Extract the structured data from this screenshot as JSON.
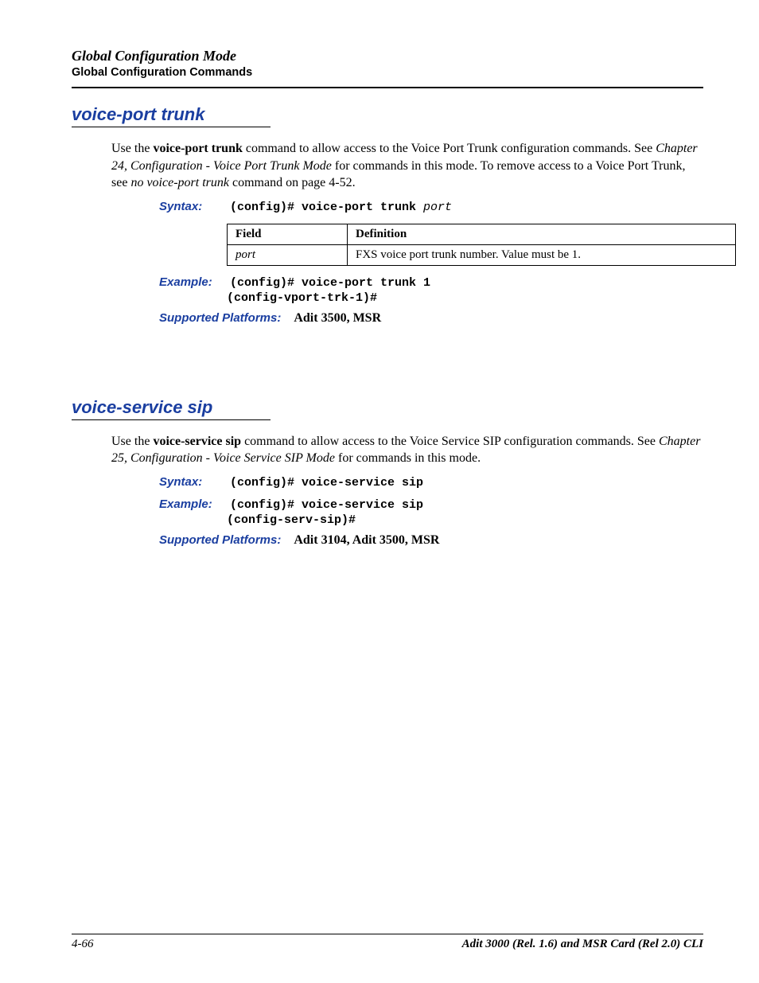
{
  "header": {
    "title": "Global Configuration Mode",
    "subtitle": "Global Configuration Commands"
  },
  "sections": [
    {
      "title": "voice-port trunk",
      "para": {
        "pre": "Use the ",
        "cmd": "voice-port trunk",
        "post1": " command to allow access to the Voice Port Trunk configuration commands. See ",
        "ref": "Chapter 24, Configuration - Voice Port Trunk Mode",
        "post2": " for commands in this mode. To remove access to a Voice Port Trunk, see  ",
        "ref2": "no voice-port trunk",
        "post3": " command on page 4-52."
      },
      "syntax": {
        "label": "Syntax:",
        "prefix": "(config)# ",
        "cmd": "voice-port trunk ",
        "arg": "port"
      },
      "table": {
        "h1": "Field",
        "h2": "Definition",
        "r1c1": "port",
        "r1c2": "FXS voice port trunk number. Value must be 1."
      },
      "example": {
        "label": "Example:",
        "line1": "(config)# voice-port trunk 1",
        "line2": "(config-vport-trk-1)#"
      },
      "platforms": {
        "label": "Supported Platforms:",
        "value": "Adit 3500, MSR"
      }
    },
    {
      "title": "voice-service sip",
      "para": {
        "pre": "Use the ",
        "cmd": "voice-service sip",
        "post1": " command to allow access to the Voice Service SIP configuration commands. See ",
        "ref": "Chapter 25, Configuration - Voice Service SIP Mode",
        "post2": " for commands in this mode."
      },
      "syntax": {
        "label": "Syntax:",
        "line": "(config)# voice-service sip"
      },
      "example": {
        "label": "Example:",
        "line1": "(config)# voice-service sip",
        "line2": "(config-serv-sip)#"
      },
      "platforms": {
        "label": "Supported Platforms:",
        "value": "Adit 3104, Adit 3500, MSR"
      }
    }
  ],
  "footer": {
    "left": "4-66",
    "right": "Adit 3000 (Rel. 1.6) and MSR Card (Rel 2.0) CLI"
  }
}
